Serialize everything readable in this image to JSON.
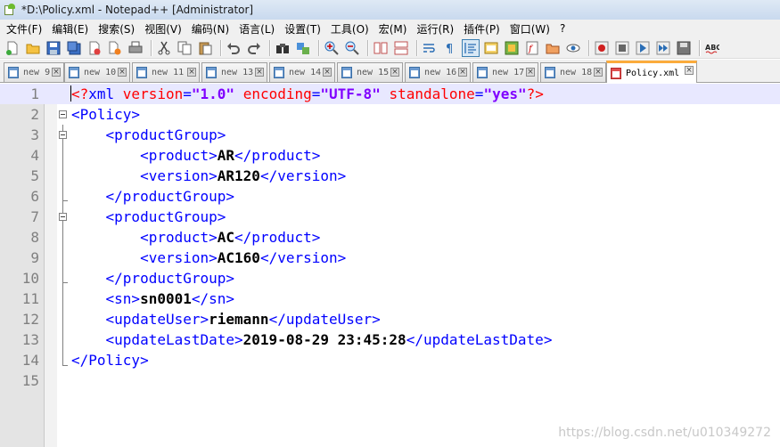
{
  "window": {
    "title": "*D:\\Policy.xml - Notepad++ [Administrator]"
  },
  "menu": [
    "文件(F)",
    "编辑(E)",
    "搜索(S)",
    "视图(V)",
    "编码(N)",
    "语言(L)",
    "设置(T)",
    "工具(O)",
    "宏(M)",
    "运行(R)",
    "插件(P)",
    "窗口(W)",
    "?"
  ],
  "tabs": [
    {
      "label": "new 9"
    },
    {
      "label": "new 10"
    },
    {
      "label": "new 11"
    },
    {
      "label": "new 13"
    },
    {
      "label": "new 14"
    },
    {
      "label": "new 15"
    },
    {
      "label": "new 16"
    },
    {
      "label": "new 17"
    },
    {
      "label": "new 18"
    },
    {
      "label": "Policy.xml",
      "active": true
    }
  ],
  "tab_close_glyph": "×",
  "editor": {
    "current_line": 1,
    "lines": [
      {
        "n": "1",
        "indent": "",
        "parts": [
          [
            "pi",
            "<?"
          ],
          [
            "t",
            "xml "
          ],
          [
            "an",
            "version"
          ],
          [
            "t",
            "="
          ],
          [
            "av",
            "\"1.0\""
          ],
          [
            "t",
            " "
          ],
          [
            "an",
            "encoding"
          ],
          [
            "t",
            "="
          ],
          [
            "av",
            "\"UTF-8\""
          ],
          [
            "t",
            " "
          ],
          [
            "an",
            "standalone"
          ],
          [
            "t",
            "="
          ],
          [
            "av",
            "\"yes\""
          ],
          [
            "pi",
            "?>"
          ]
        ]
      },
      {
        "n": "2",
        "indent": "",
        "parts": [
          [
            "t",
            "<Policy>"
          ]
        ]
      },
      {
        "n": "3",
        "indent": "    ",
        "parts": [
          [
            "t",
            "<productGroup>"
          ]
        ]
      },
      {
        "n": "4",
        "indent": "        ",
        "parts": [
          [
            "t",
            "<product>"
          ],
          [
            "d",
            "AR"
          ],
          [
            "t",
            "</product>"
          ]
        ]
      },
      {
        "n": "5",
        "indent": "        ",
        "parts": [
          [
            "t",
            "<version>"
          ],
          [
            "d",
            "AR120"
          ],
          [
            "t",
            "</version>"
          ]
        ]
      },
      {
        "n": "6",
        "indent": "    ",
        "parts": [
          [
            "t",
            "</productGroup>"
          ]
        ]
      },
      {
        "n": "7",
        "indent": "    ",
        "parts": [
          [
            "t",
            "<productGroup>"
          ]
        ]
      },
      {
        "n": "8",
        "indent": "        ",
        "parts": [
          [
            "t",
            "<product>"
          ],
          [
            "d",
            "AC"
          ],
          [
            "t",
            "</product>"
          ]
        ]
      },
      {
        "n": "9",
        "indent": "        ",
        "parts": [
          [
            "t",
            "<version>"
          ],
          [
            "d",
            "AC160"
          ],
          [
            "t",
            "</version>"
          ]
        ]
      },
      {
        "n": "10",
        "indent": "    ",
        "parts": [
          [
            "t",
            "</productGroup>"
          ]
        ]
      },
      {
        "n": "11",
        "indent": "    ",
        "parts": [
          [
            "t",
            "<sn>"
          ],
          [
            "d",
            "sn0001"
          ],
          [
            "t",
            "</sn>"
          ]
        ]
      },
      {
        "n": "12",
        "indent": "    ",
        "parts": [
          [
            "t",
            "<updateUser>"
          ],
          [
            "d",
            "riemann"
          ],
          [
            "t",
            "</updateUser>"
          ]
        ]
      },
      {
        "n": "13",
        "indent": "    ",
        "parts": [
          [
            "t",
            "<updateLastDate>"
          ],
          [
            "d",
            "2019-08-29 23:45:28"
          ],
          [
            "t",
            "</updateLastDate>"
          ]
        ]
      },
      {
        "n": "14",
        "indent": "",
        "parts": [
          [
            "t",
            "</Policy>"
          ]
        ]
      },
      {
        "n": "15",
        "indent": "",
        "parts": []
      }
    ]
  },
  "watermark": "https://blog.csdn.net/u010349272",
  "colors": {
    "tag": "#0000ff",
    "attribute_name": "#ff0000",
    "attribute_value": "#8000ff",
    "current_line": "#e8e8ff",
    "active_tab_accent": "#fbab3c"
  },
  "toolbar_icons": [
    "new-file-icon",
    "open-file-icon",
    "save-icon",
    "save-all-icon",
    "close-icon",
    "close-all-icon",
    "print-icon",
    "cut-icon",
    "copy-icon",
    "paste-icon",
    "undo-icon",
    "redo-icon",
    "find-icon",
    "replace-icon",
    "zoom-in-icon",
    "zoom-out-icon",
    "sync-v-icon",
    "sync-h-icon",
    "word-wrap-icon",
    "show-all-chars-icon",
    "indent-guide-icon",
    "udl-icon",
    "doc-map-icon",
    "function-list-icon",
    "folder-workspace-icon",
    "monitor-icon",
    "record-macro-icon",
    "stop-macro-icon",
    "play-macro-icon",
    "run-macro-multiple-icon",
    "save-macro-icon",
    "spell-check-icon"
  ]
}
